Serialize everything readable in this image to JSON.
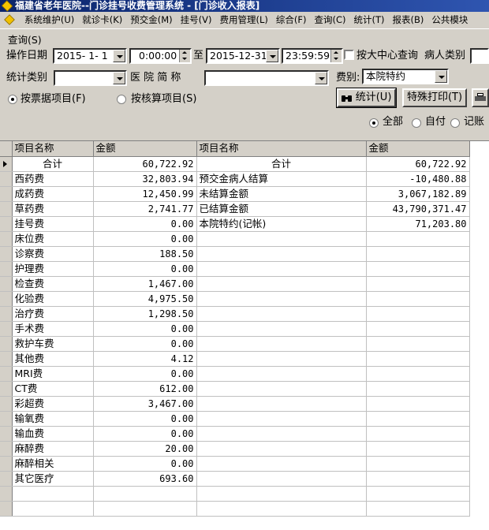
{
  "window": {
    "title": "福建省老年医院--门诊挂号收费管理系统 - [门诊收入报表]"
  },
  "menu": [
    {
      "label": "系统维护(U)"
    },
    {
      "label": "就诊卡(K)"
    },
    {
      "label": "预交金(M)"
    },
    {
      "label": "挂号(V)"
    },
    {
      "label": "费用管理(L)"
    },
    {
      "label": "综合(F)"
    },
    {
      "label": "查询(C)"
    },
    {
      "label": "统计(T)"
    },
    {
      "label": "报表(B)"
    },
    {
      "label": "公共模块"
    }
  ],
  "query": {
    "group_title": "查询(S)",
    "date_label": "操作日期",
    "start_date": "2015- 1- 1",
    "start_time": "0:00:00",
    "to_label": "至",
    "end_date": "2015-12-31",
    "end_time": "23:59:59",
    "big_center_label": "按大中心查询",
    "patient_type_label": "病人类别",
    "patient_type_value": "",
    "stat_type_label": "统计类别",
    "stat_type_value": "",
    "hospital_abbr_label": "医 院 简 称",
    "hospital_abbr_value": "",
    "fee_type_label": "费别:",
    "fee_type_value": "本院特约",
    "by_receipt_label": "按票据项目(F)",
    "by_accounting_label": "按核算项目(S)",
    "stat_button": "统计(U)",
    "special_print_button": "特殊打印(T)",
    "all_label": "全部",
    "self_pay_label": "自付",
    "credit_label": "记账"
  },
  "table": {
    "headers": [
      "项目名称",
      "金额",
      "项目名称",
      "金额"
    ],
    "rows": [
      [
        "合计",
        "60,722.92",
        "合计",
        "60,722.92"
      ],
      [
        "西药费",
        "32,803.94",
        "预交金病人结算",
        "-10,480.88"
      ],
      [
        "成药费",
        "12,450.99",
        "未结算金额",
        "3,067,182.89"
      ],
      [
        "草药费",
        "2,741.77",
        "已结算金额",
        "43,790,371.47"
      ],
      [
        "挂号费",
        "0.00",
        "本院特约(记帐)",
        "71,203.80"
      ],
      [
        "床位费",
        "0.00",
        "",
        ""
      ],
      [
        "诊察费",
        "188.50",
        "",
        ""
      ],
      [
        "护理费",
        "0.00",
        "",
        ""
      ],
      [
        "检查费",
        "1,467.00",
        "",
        ""
      ],
      [
        "化验费",
        "4,975.50",
        "",
        ""
      ],
      [
        "治疗费",
        "1,298.50",
        "",
        ""
      ],
      [
        "手术费",
        "0.00",
        "",
        ""
      ],
      [
        "救护车费",
        "0.00",
        "",
        ""
      ],
      [
        "其他费",
        "4.12",
        "",
        ""
      ],
      [
        "MRI费",
        "0.00",
        "",
        ""
      ],
      [
        "CT费",
        "612.00",
        "",
        ""
      ],
      [
        "彩超费",
        "3,467.00",
        "",
        ""
      ],
      [
        "输氧费",
        "0.00",
        "",
        ""
      ],
      [
        "输血费",
        "0.00",
        "",
        ""
      ],
      [
        "麻醉费",
        "20.00",
        "",
        ""
      ],
      [
        "麻醉相关",
        "0.00",
        "",
        ""
      ],
      [
        "其它医疗",
        "693.60",
        "",
        ""
      ],
      [
        "",
        "",
        "",
        ""
      ],
      [
        "",
        "",
        "",
        ""
      ]
    ]
  }
}
